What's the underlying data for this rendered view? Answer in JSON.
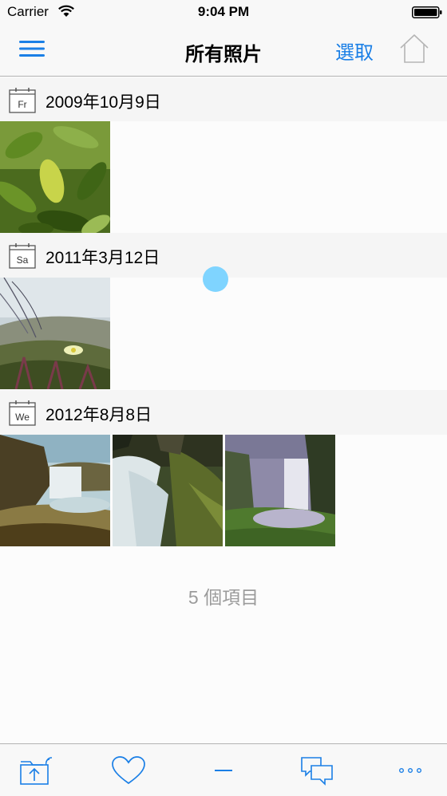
{
  "status_bar": {
    "carrier": "Carrier",
    "time": "9:04 PM"
  },
  "nav": {
    "title": "所有照片",
    "select_label": "選取"
  },
  "sections": [
    {
      "weekday": "Fr",
      "date": "2009年10月9日",
      "photos": [
        "leaves"
      ]
    },
    {
      "weekday": "Sa",
      "date": "2011年3月12日",
      "photos": [
        "flower-grass"
      ]
    },
    {
      "weekday": "We",
      "date": "2012年8月8日",
      "photos": [
        "waterfall-1",
        "waterfall-2",
        "waterfall-3"
      ]
    }
  ],
  "footer": {
    "item_count": "5 個項目"
  },
  "toolbar": {
    "buttons": [
      "share-folder-icon",
      "heart-icon",
      "minus-icon",
      "chat-bubbles-icon",
      "more-icon"
    ]
  },
  "colors": {
    "accent": "#1a7fe6",
    "muted": "#9b9b9b",
    "touch": "#7fd4ff"
  }
}
